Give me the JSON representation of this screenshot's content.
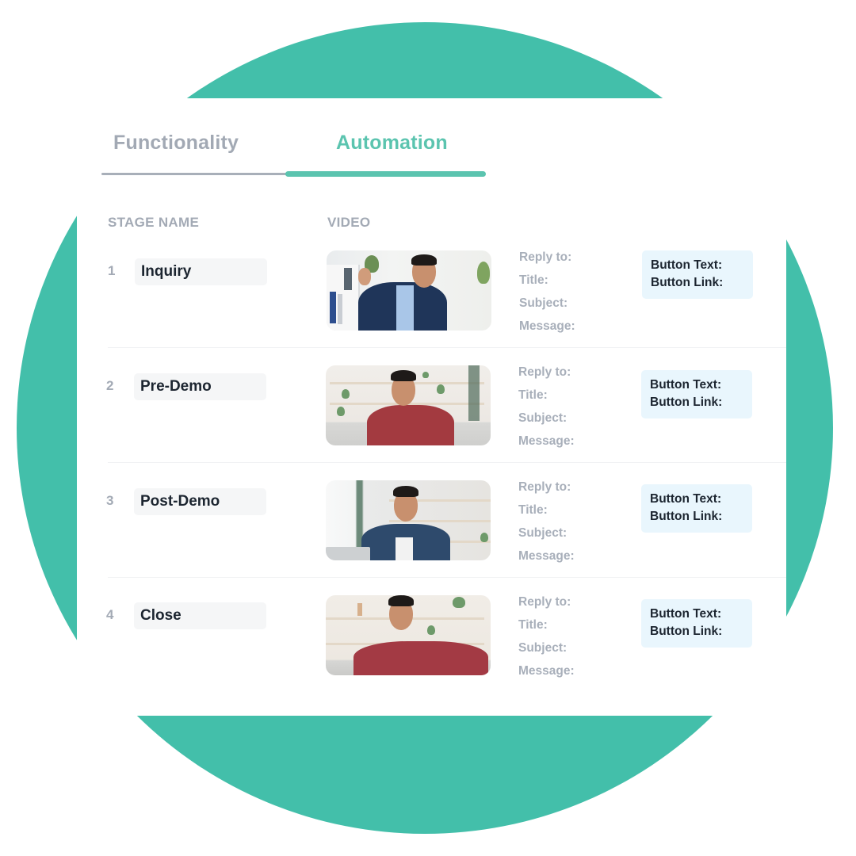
{
  "colors": {
    "accent": "#43BFAA",
    "active_tab": "#5BC4AF",
    "inactive_tab": "#A2A9B4",
    "label_gray": "#A8AFBA",
    "dark_text": "#1C2530",
    "button_box_bg": "#E9F6FD",
    "name_box_bg": "#F5F6F7"
  },
  "tabs": [
    {
      "label": "Functionality",
      "active": false
    },
    {
      "label": "Automation",
      "active": true
    }
  ],
  "columns": {
    "stage_name": "STAGE NAME",
    "video": "VIDEO"
  },
  "stages": [
    {
      "number": "1",
      "name": "Inquiry",
      "video_thumbnail": "man-in-blue-suit-waving-office",
      "fields": [
        "Reply to:",
        "Title:",
        "Subject:",
        "Message:"
      ],
      "button_fields": [
        "Button Text:",
        "Button Link:"
      ]
    },
    {
      "number": "2",
      "name": "Pre-Demo",
      "video_thumbnail": "man-in-red-shirt-smiling-living-room",
      "fields": [
        "Reply to:",
        "Title:",
        "Subject:",
        "Message:"
      ],
      "button_fields": [
        "Button Text:",
        "Button Link:"
      ]
    },
    {
      "number": "3",
      "name": "Post-Demo",
      "video_thumbnail": "man-in-denim-shirt-at-laptop",
      "fields": [
        "Reply to:",
        "Title:",
        "Subject:",
        "Message:"
      ],
      "button_fields": [
        "Button Text:",
        "Button Link:"
      ]
    },
    {
      "number": "4",
      "name": "Close",
      "video_thumbnail": "man-in-red-shirt-on-sofa",
      "fields": [
        "Reply to:",
        "Title:",
        "Subject:",
        "Message:"
      ],
      "button_fields": [
        "Button Text:",
        "Button Link:"
      ]
    }
  ]
}
